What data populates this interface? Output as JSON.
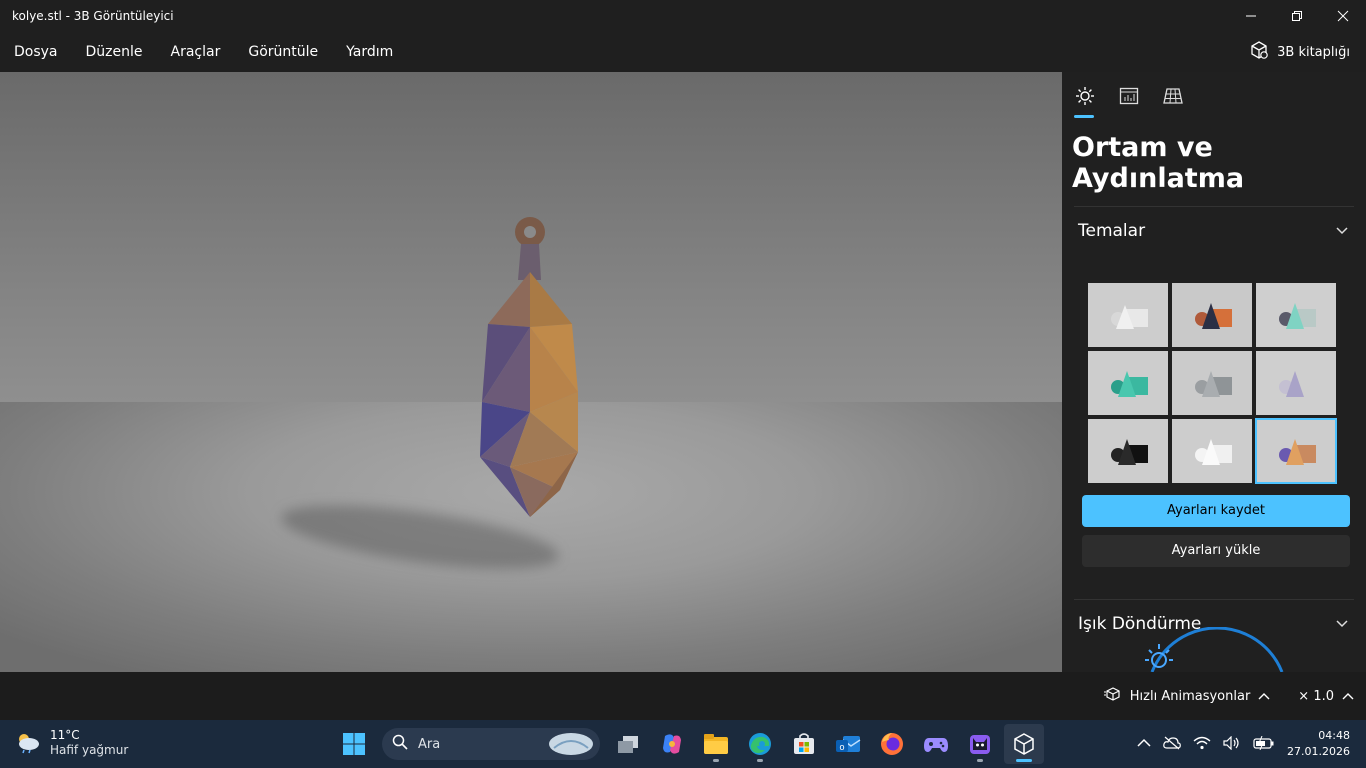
{
  "window": {
    "title": "kolye.stl - 3B Görüntüleyici",
    "controls": [
      "—",
      "□",
      "✕"
    ]
  },
  "menu": {
    "items": [
      "Dosya",
      "Düzenle",
      "Araçlar",
      "Görüntüle",
      "Yardım"
    ],
    "library_label": "3B kitaplığı"
  },
  "panel": {
    "tabs": [
      "environment-icon",
      "stats-icon",
      "grid-icon"
    ],
    "title": "Ortam ve Aydınlatma",
    "themes_label": "Temalar",
    "save_button": "Ayarları kaydet",
    "load_button": "Ayarları yükle",
    "light_rotation_label": "Işık Döndürme",
    "accent": "#4cc2ff"
  },
  "bottombar": {
    "animation_label": "Hızlı Animasyonlar",
    "speed": "× 1.0"
  },
  "taskbar": {
    "weather_temp": "11°C",
    "weather_desc": "Hafif yağmur",
    "search_placeholder": "Ara",
    "time": "04:48",
    "date": "27.01.2026"
  }
}
